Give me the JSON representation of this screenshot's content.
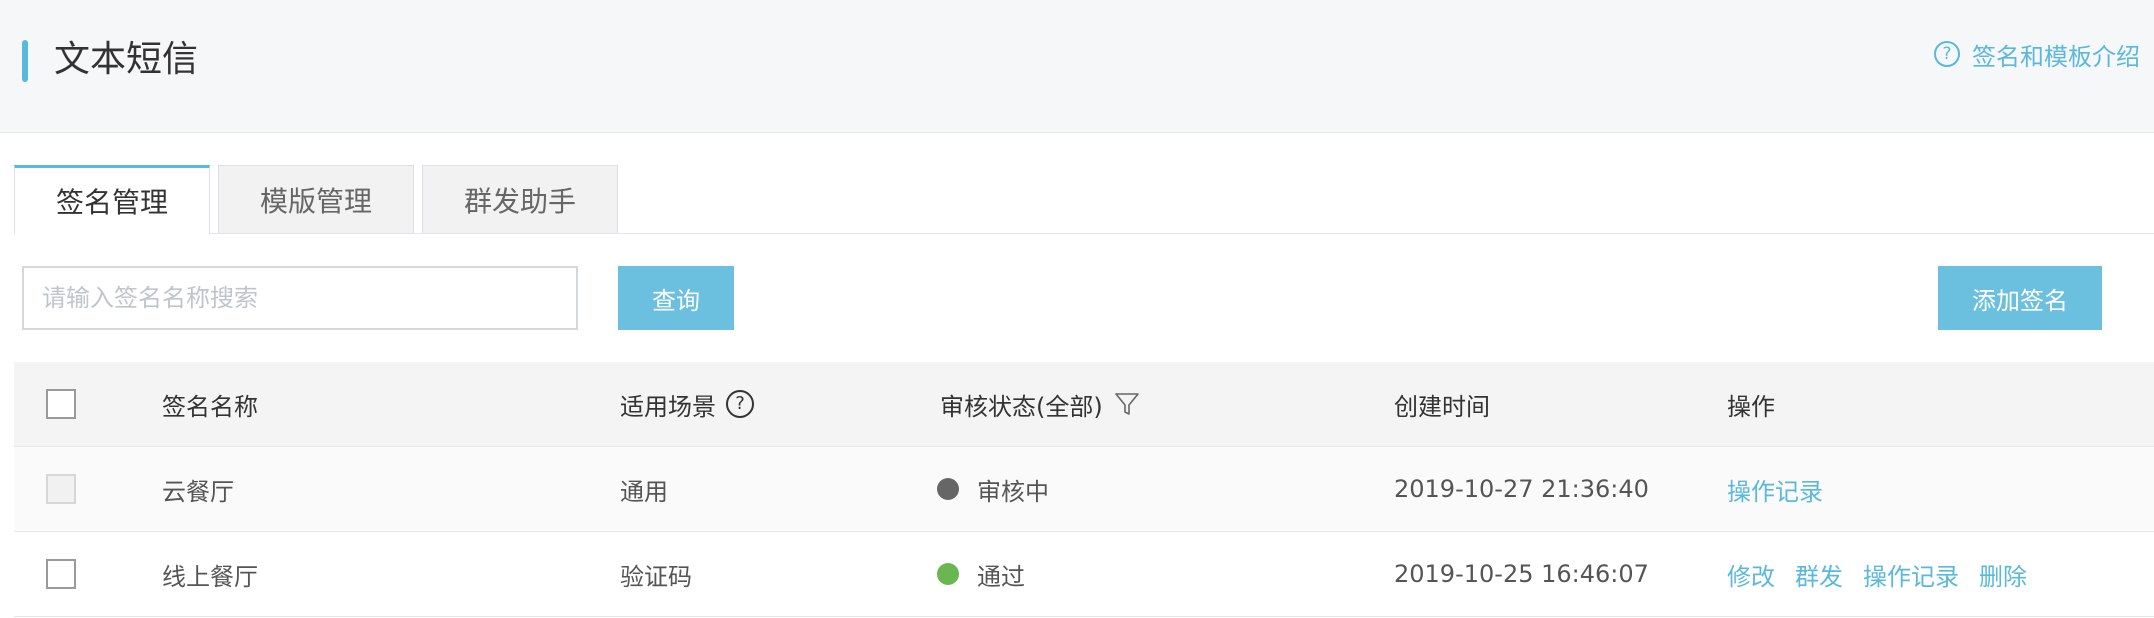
{
  "header": {
    "title": "文本短信",
    "help_link": "签名和模板介绍",
    "help_icon_glyph": "?"
  },
  "tabs": [
    {
      "label": "签名管理",
      "active": true
    },
    {
      "label": "模版管理",
      "active": false
    },
    {
      "label": "群发助手",
      "active": false
    }
  ],
  "toolbar": {
    "search_placeholder": "请输入签名名称搜索",
    "search_value": "",
    "query_label": "查询",
    "add_label": "添加签名"
  },
  "table": {
    "columns": {
      "name": "签名名称",
      "scene": "适用场景",
      "status": "审核状态(全部)",
      "created": "创建时间",
      "actions": "操作"
    },
    "scene_help_glyph": "?",
    "rows": [
      {
        "name": "云餐厅",
        "scene": "通用",
        "status": "审核中",
        "status_color": "#666666",
        "created": "2019-10-27 21:36:40",
        "actions": [
          "操作记录"
        ],
        "checkbox_disabled": true
      },
      {
        "name": "线上餐厅",
        "scene": "验证码",
        "status": "通过",
        "status_color": "#6ab650",
        "created": "2019-10-25 16:46:07",
        "actions": [
          "修改",
          "群发",
          "操作记录",
          "删除"
        ],
        "checkbox_disabled": false
      }
    ]
  },
  "colors": {
    "accent": "#5bb8dd",
    "button": "#6bbfdf",
    "header_bg": "#f6f7f9"
  }
}
